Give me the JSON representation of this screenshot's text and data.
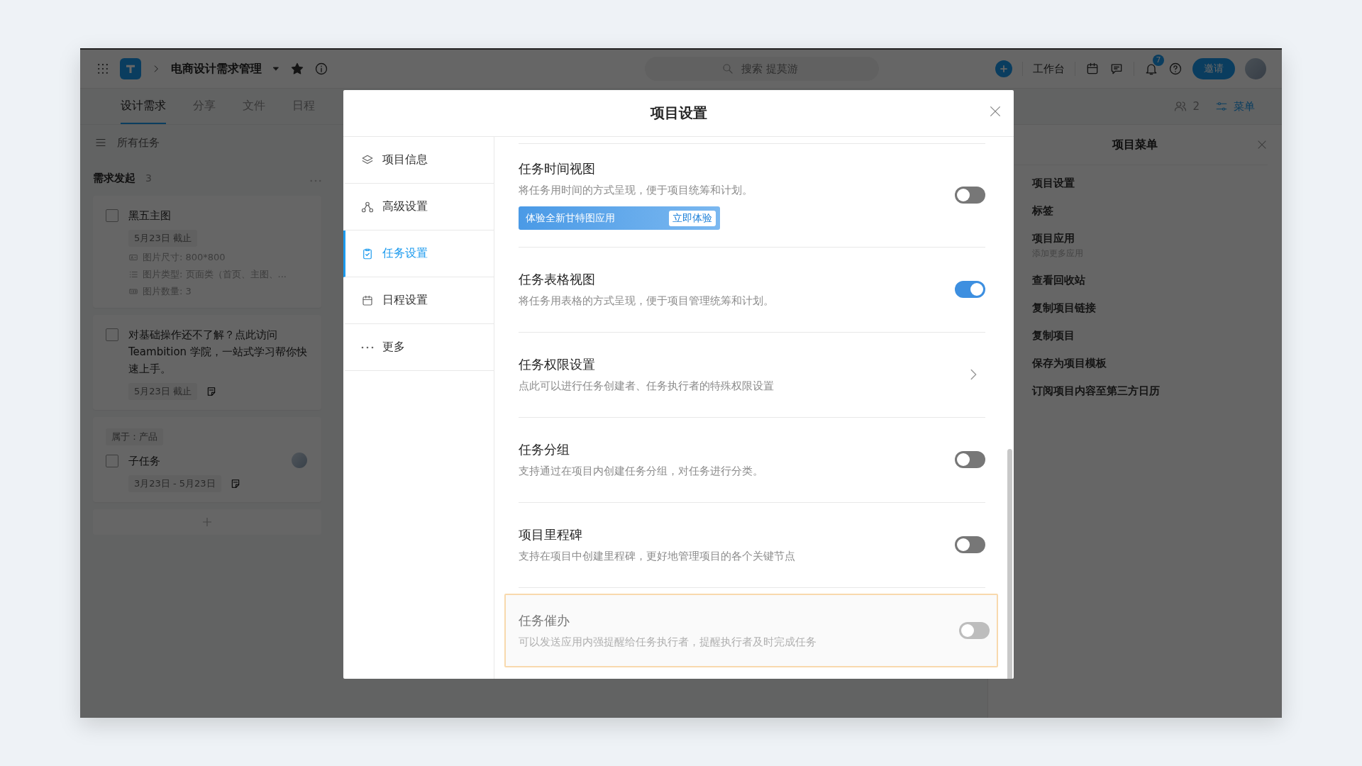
{
  "topbar": {
    "project_name": "电商设计需求管理",
    "search": {
      "placeholder": "搜索 提莫游"
    },
    "workbench": "工作台",
    "notification_count": "7",
    "invite": "邀请"
  },
  "tabs": [
    {
      "label": "设计需求",
      "selected": true
    },
    {
      "label": "分享",
      "selected": false
    },
    {
      "label": "文件",
      "selected": false
    },
    {
      "label": "日程",
      "selected": false
    }
  ],
  "toolbar": {
    "member_count": "2",
    "menu": "菜单"
  },
  "task_view": {
    "filter": "所有任务"
  },
  "column": {
    "title": "需求发起",
    "count": "3"
  },
  "cards": [
    {
      "title": "黑五主图",
      "checked": false,
      "due": "5月23日 截止",
      "note": false,
      "avatar": false,
      "fields": [
        {
          "kind": "text",
          "text": "图片尺寸: 800*800"
        },
        {
          "kind": "list",
          "text": "图片类型: 页面类（首页、主图、..."
        },
        {
          "kind": "number",
          "text": "图片数量: 3"
        }
      ]
    },
    {
      "title": "对基础操作还不了解？点此访问 Teambition 学院，一站式学习帮你快速上手。",
      "checked": false,
      "due": "5月23日 截止",
      "note": true,
      "avatar": false
    },
    {
      "parent": "属于：产品",
      "title": "子任务",
      "checked": false,
      "due": "3月23日 - 5月23日",
      "note": true,
      "avatar": true
    }
  ],
  "project_menu": {
    "title": "项目菜单",
    "items": [
      {
        "label": "项目设置"
      },
      {
        "label": "标签"
      },
      {
        "label": "项目应用",
        "sublabel": "添加更多应用"
      },
      {
        "label": "查看回收站"
      },
      {
        "label": "复制项目链接"
      },
      {
        "label": "复制项目"
      },
      {
        "label": "保存为项目模板"
      },
      {
        "label": "订阅项目内容至第三方日历"
      }
    ]
  },
  "dialog": {
    "title": "项目设置",
    "nav": [
      {
        "label": "项目信息",
        "kind": "layers",
        "selected": false
      },
      {
        "label": "高级设置",
        "kind": "nodes",
        "selected": false
      },
      {
        "label": "任务设置",
        "kind": "clipboard",
        "selected": true
      },
      {
        "label": "日程设置",
        "kind": "calendar",
        "selected": false
      },
      {
        "label": "更多",
        "kind": "more",
        "selected": false
      }
    ],
    "settings": [
      {
        "kind": "toggle",
        "title": "任务时间视图",
        "description": "将任务用时间的方式呈现，便于项目统筹和计划。",
        "on": false,
        "disabled": false,
        "highlighted": false,
        "banner": {
          "text": "体验全新甘特图应用",
          "button": "立即体验"
        }
      },
      {
        "kind": "toggle",
        "title": "任务表格视图",
        "description": "将任务用表格的方式呈现，便于项目管理统筹和计划。",
        "on": true,
        "disabled": false,
        "highlighted": false
      },
      {
        "kind": "link",
        "title": "任务权限设置",
        "description": "点此可以进行任务创建者、任务执行者的特殊权限设置",
        "disabled": false,
        "highlighted": false
      },
      {
        "kind": "toggle",
        "title": "任务分组",
        "description": "支持通过在项目内创建任务分组，对任务进行分类。",
        "on": false,
        "disabled": false,
        "highlighted": false
      },
      {
        "kind": "toggle",
        "title": "项目里程碑",
        "description": "支持在项目中创建里程碑，更好地管理项目的各个关键节点",
        "on": false,
        "disabled": false,
        "highlighted": false
      },
      {
        "kind": "toggle",
        "title": "任务催办",
        "description": "可以发送应用内强提醒给任务执行者，提醒执行者及时完成任务",
        "on": false,
        "disabled": true,
        "highlighted": true
      }
    ]
  }
}
